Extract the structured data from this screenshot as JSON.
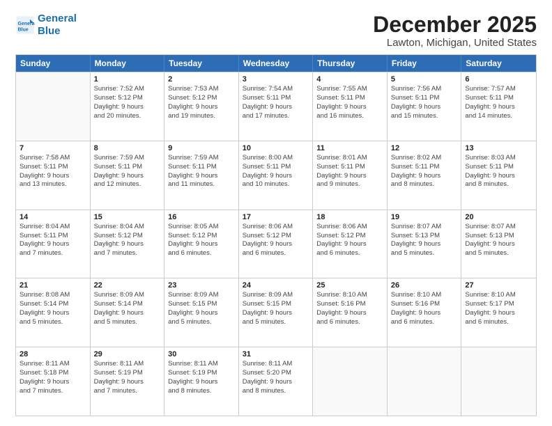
{
  "logo": {
    "line1": "General",
    "line2": "Blue"
  },
  "title": "December 2025",
  "subtitle": "Lawton, Michigan, United States",
  "days_of_week": [
    "Sunday",
    "Monday",
    "Tuesday",
    "Wednesday",
    "Thursday",
    "Friday",
    "Saturday"
  ],
  "weeks": [
    [
      {
        "day": "",
        "info": ""
      },
      {
        "day": "1",
        "info": "Sunrise: 7:52 AM\nSunset: 5:12 PM\nDaylight: 9 hours\nand 20 minutes."
      },
      {
        "day": "2",
        "info": "Sunrise: 7:53 AM\nSunset: 5:12 PM\nDaylight: 9 hours\nand 19 minutes."
      },
      {
        "day": "3",
        "info": "Sunrise: 7:54 AM\nSunset: 5:11 PM\nDaylight: 9 hours\nand 17 minutes."
      },
      {
        "day": "4",
        "info": "Sunrise: 7:55 AM\nSunset: 5:11 PM\nDaylight: 9 hours\nand 16 minutes."
      },
      {
        "day": "5",
        "info": "Sunrise: 7:56 AM\nSunset: 5:11 PM\nDaylight: 9 hours\nand 15 minutes."
      },
      {
        "day": "6",
        "info": "Sunrise: 7:57 AM\nSunset: 5:11 PM\nDaylight: 9 hours\nand 14 minutes."
      }
    ],
    [
      {
        "day": "7",
        "info": "Sunrise: 7:58 AM\nSunset: 5:11 PM\nDaylight: 9 hours\nand 13 minutes."
      },
      {
        "day": "8",
        "info": "Sunrise: 7:59 AM\nSunset: 5:11 PM\nDaylight: 9 hours\nand 12 minutes."
      },
      {
        "day": "9",
        "info": "Sunrise: 7:59 AM\nSunset: 5:11 PM\nDaylight: 9 hours\nand 11 minutes."
      },
      {
        "day": "10",
        "info": "Sunrise: 8:00 AM\nSunset: 5:11 PM\nDaylight: 9 hours\nand 10 minutes."
      },
      {
        "day": "11",
        "info": "Sunrise: 8:01 AM\nSunset: 5:11 PM\nDaylight: 9 hours\nand 9 minutes."
      },
      {
        "day": "12",
        "info": "Sunrise: 8:02 AM\nSunset: 5:11 PM\nDaylight: 9 hours\nand 8 minutes."
      },
      {
        "day": "13",
        "info": "Sunrise: 8:03 AM\nSunset: 5:11 PM\nDaylight: 9 hours\nand 8 minutes."
      }
    ],
    [
      {
        "day": "14",
        "info": "Sunrise: 8:04 AM\nSunset: 5:11 PM\nDaylight: 9 hours\nand 7 minutes."
      },
      {
        "day": "15",
        "info": "Sunrise: 8:04 AM\nSunset: 5:12 PM\nDaylight: 9 hours\nand 7 minutes."
      },
      {
        "day": "16",
        "info": "Sunrise: 8:05 AM\nSunset: 5:12 PM\nDaylight: 9 hours\nand 6 minutes."
      },
      {
        "day": "17",
        "info": "Sunrise: 8:06 AM\nSunset: 5:12 PM\nDaylight: 9 hours\nand 6 minutes."
      },
      {
        "day": "18",
        "info": "Sunrise: 8:06 AM\nSunset: 5:12 PM\nDaylight: 9 hours\nand 6 minutes."
      },
      {
        "day": "19",
        "info": "Sunrise: 8:07 AM\nSunset: 5:13 PM\nDaylight: 9 hours\nand 5 minutes."
      },
      {
        "day": "20",
        "info": "Sunrise: 8:07 AM\nSunset: 5:13 PM\nDaylight: 9 hours\nand 5 minutes."
      }
    ],
    [
      {
        "day": "21",
        "info": "Sunrise: 8:08 AM\nSunset: 5:14 PM\nDaylight: 9 hours\nand 5 minutes."
      },
      {
        "day": "22",
        "info": "Sunrise: 8:09 AM\nSunset: 5:14 PM\nDaylight: 9 hours\nand 5 minutes."
      },
      {
        "day": "23",
        "info": "Sunrise: 8:09 AM\nSunset: 5:15 PM\nDaylight: 9 hours\nand 5 minutes."
      },
      {
        "day": "24",
        "info": "Sunrise: 8:09 AM\nSunset: 5:15 PM\nDaylight: 9 hours\nand 5 minutes."
      },
      {
        "day": "25",
        "info": "Sunrise: 8:10 AM\nSunset: 5:16 PM\nDaylight: 9 hours\nand 6 minutes."
      },
      {
        "day": "26",
        "info": "Sunrise: 8:10 AM\nSunset: 5:16 PM\nDaylight: 9 hours\nand 6 minutes."
      },
      {
        "day": "27",
        "info": "Sunrise: 8:10 AM\nSunset: 5:17 PM\nDaylight: 9 hours\nand 6 minutes."
      }
    ],
    [
      {
        "day": "28",
        "info": "Sunrise: 8:11 AM\nSunset: 5:18 PM\nDaylight: 9 hours\nand 7 minutes."
      },
      {
        "day": "29",
        "info": "Sunrise: 8:11 AM\nSunset: 5:19 PM\nDaylight: 9 hours\nand 7 minutes."
      },
      {
        "day": "30",
        "info": "Sunrise: 8:11 AM\nSunset: 5:19 PM\nDaylight: 9 hours\nand 8 minutes."
      },
      {
        "day": "31",
        "info": "Sunrise: 8:11 AM\nSunset: 5:20 PM\nDaylight: 9 hours\nand 8 minutes."
      },
      {
        "day": "",
        "info": ""
      },
      {
        "day": "",
        "info": ""
      },
      {
        "day": "",
        "info": ""
      }
    ]
  ]
}
